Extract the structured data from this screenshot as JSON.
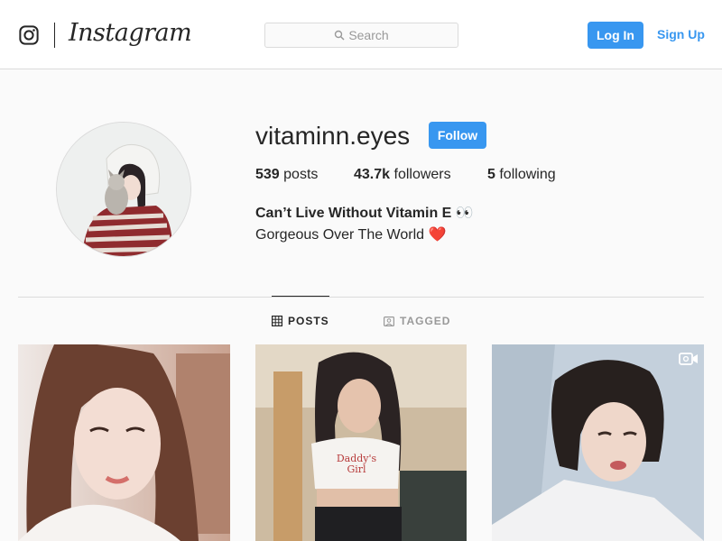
{
  "nav": {
    "wordmark": "Instagram",
    "search_placeholder": "Search",
    "login_label": "Log In",
    "signup_label": "Sign Up"
  },
  "profile": {
    "username": "vitaminn.eyes",
    "follow_label": "Follow",
    "stats": [
      {
        "value": "539",
        "label": "posts"
      },
      {
        "value": "43.7k",
        "label": "followers"
      },
      {
        "value": "5",
        "label": "following"
      }
    ],
    "bio_name": "Can’t Live Without Vitamin E 👀",
    "bio_text": "Gorgeous Over The World",
    "bio_emoji": "❤️"
  },
  "tabs": [
    {
      "label": "POSTS",
      "active": true
    },
    {
      "label": "TAGGED",
      "active": false
    }
  ],
  "icons": {
    "instagram_glyph": "instagram-glyph-icon",
    "search": "search-icon",
    "posts_tab": "grid-icon",
    "tagged_tab": "tagged-person-icon",
    "video_badge": "video-icon"
  },
  "colors": {
    "accent": "#3897f0",
    "text": "#262626",
    "muted": "#999999",
    "border": "#dbdbdb",
    "background": "#fafafa"
  }
}
